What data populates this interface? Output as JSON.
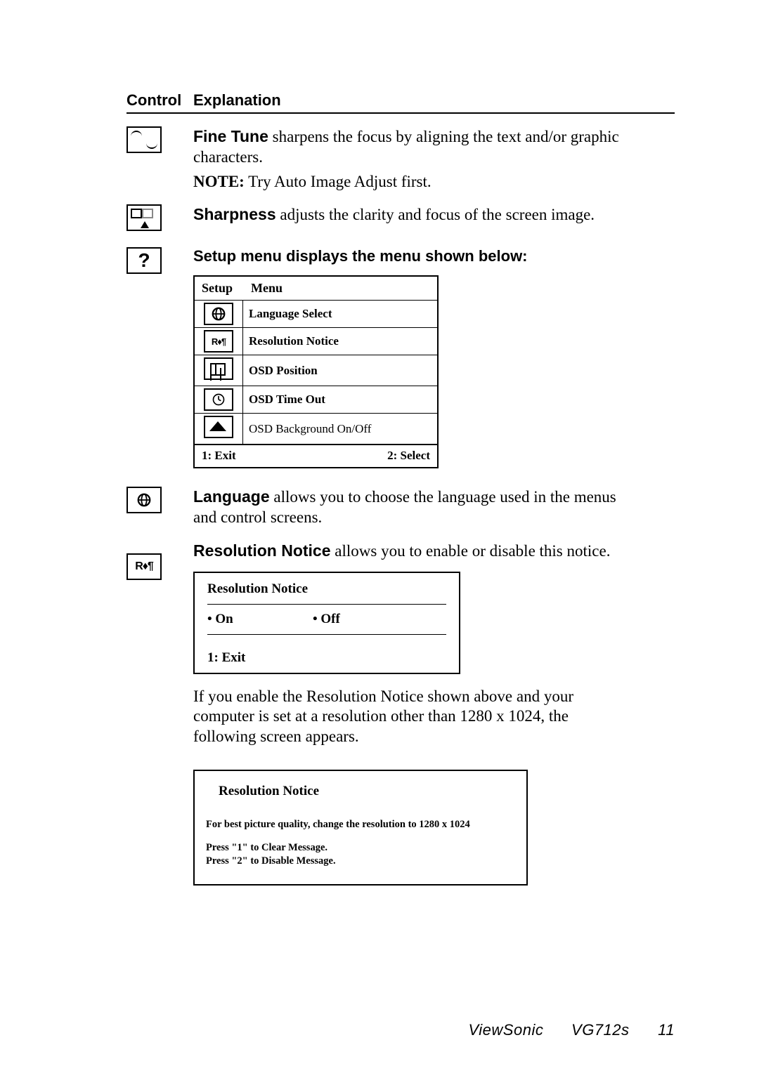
{
  "headers": {
    "control": "Control",
    "explanation": "Explanation"
  },
  "finetune": {
    "title": "Fine Tune",
    "text_after": " sharpens the focus by aligning the text and/or graphic characters.",
    "note_label": "NOTE:",
    "note_text": " Try Auto Image Adjust first."
  },
  "sharpness": {
    "title": "Sharpness",
    "text_after": " adjusts the clarity and focus of the screen image."
  },
  "setup_heading": "Setup menu displays the menu shown below:",
  "setup_menu": {
    "head_left": "Setup",
    "head_right": "Menu",
    "items": [
      {
        "label": "Language Select",
        "normal": false
      },
      {
        "label": "Resolution Notice",
        "normal": false
      },
      {
        "label": "OSD Position",
        "normal": false
      },
      {
        "label": "OSD Time Out",
        "normal": false
      },
      {
        "label": "OSD Background On/Off",
        "normal": true
      }
    ],
    "foot_left": "1: Exit",
    "foot_right": "2: Select",
    "res_icon_text": "R♦¶"
  },
  "language": {
    "title": "Language",
    "text_after": " allows you to choose the language used in the menus and control screens."
  },
  "resnotice": {
    "title": "Resolution Notice",
    "text_after": " allows you to enable or disable this notice.",
    "box_title": "Resolution Notice",
    "opt_on": "• On",
    "opt_off": "• Off",
    "exit": "1: Exit"
  },
  "res_follow": "If you enable the Resolution Notice shown above and your computer is set at a resolution other than 1280 x 1024, the following screen appears.",
  "bignotice": {
    "title": "Resolution Notice",
    "line1": "For best picture quality, change the resolution to 1280 x 1024",
    "line2": "Press \"1\" to Clear Message.",
    "line3": "Press \"2\" to Disable Message."
  },
  "footer": {
    "brand": "ViewSonic",
    "model": "VG712s",
    "page": "11"
  },
  "qmark": "?"
}
